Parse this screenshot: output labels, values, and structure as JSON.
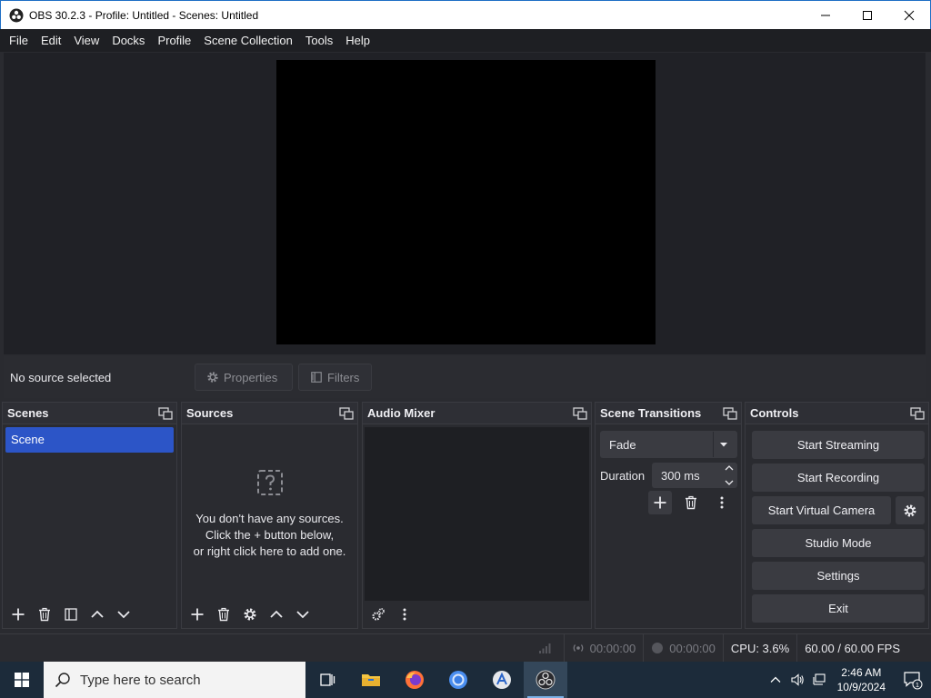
{
  "window": {
    "title": "OBS 30.2.3 - Profile: Untitled - Scenes: Untitled"
  },
  "menu": [
    "File",
    "Edit",
    "View",
    "Docks",
    "Profile",
    "Scene Collection",
    "Tools",
    "Help"
  ],
  "context_bar": {
    "status": "No source selected",
    "properties_label": "Properties",
    "filters_label": "Filters"
  },
  "scenes": {
    "title": "Scenes",
    "items": [
      "Scene"
    ]
  },
  "sources": {
    "title": "Sources",
    "empty_line1": "You don't have any sources.",
    "empty_line2": "Click the + button below,",
    "empty_line3": "or right click here to add one."
  },
  "mixer": {
    "title": "Audio Mixer"
  },
  "transitions": {
    "title": "Scene Transitions",
    "selected": "Fade",
    "duration_label": "Duration",
    "duration_value": "300 ms"
  },
  "controls": {
    "title": "Controls",
    "start_streaming": "Start Streaming",
    "start_recording": "Start Recording",
    "start_virtual_camera": "Start Virtual Camera",
    "studio_mode": "Studio Mode",
    "settings": "Settings",
    "exit": "Exit"
  },
  "status": {
    "stream_time": "00:00:00",
    "record_time": "00:00:00",
    "cpu": "CPU: 3.6%",
    "fps": "60.00 / 60.00 FPS"
  },
  "taskbar": {
    "search_placeholder": "Type here to search",
    "time": "2:46 AM",
    "date": "10/9/2024",
    "notification_count": "1"
  },
  "colors": {
    "accent_selection": "#2c55c7",
    "panel_bg": "#2a2b30",
    "button_bg": "#3a3b41"
  }
}
